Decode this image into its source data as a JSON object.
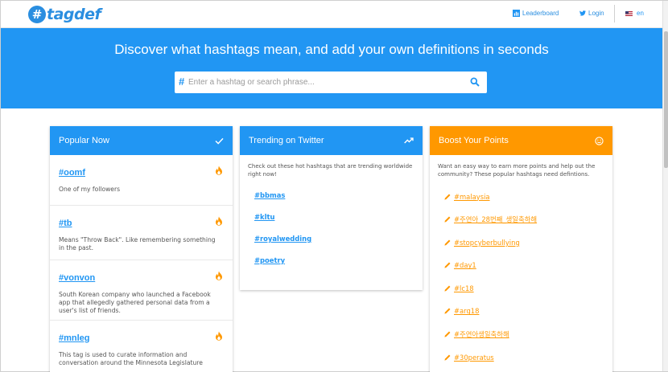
{
  "header": {
    "logo_hash": "#",
    "logo_text": "tagdef",
    "leaderboard_label": "Leaderboard",
    "login_label": "Login",
    "lang_label": "en"
  },
  "hero": {
    "title": "Discover what hashtags mean, and add your own definitions in seconds",
    "search_hash": "#",
    "search_placeholder": "Enter a hashtag or search phrase..."
  },
  "popular": {
    "title": "Popular Now",
    "items": [
      {
        "tag": "#oomf",
        "desc": "One of my followers"
      },
      {
        "tag": "#tb",
        "desc": "Means \"Throw Back\". Like remembering something in the past."
      },
      {
        "tag": "#vonvon",
        "desc": "South Korean company who launched a Facebook app that allegedly gathered personal data from a user's list of friends."
      },
      {
        "tag": "#mnleg",
        "desc": "This tag is used to curate information and conversation around the Minnesota Legislature"
      }
    ]
  },
  "trending": {
    "title": "Trending on Twitter",
    "intro": "Check out these hot hashtags that are trending worldwide right now!",
    "items": [
      "#bbmas",
      "#kltu",
      "#royalwedding",
      "#poetry"
    ]
  },
  "boost": {
    "title": "Boost Your Points",
    "intro": "Want an easy way to earn more points and help out the community? These popular hashtags need defintions.",
    "items": [
      "#malaysia",
      "#주연아_28번째_생일축하해",
      "#stopcyberbullying",
      "#day1",
      "#lc18",
      "#arg18",
      "#주연아생일축하해",
      "#30peratus"
    ]
  },
  "colors": {
    "primary": "#2196f3",
    "accent": "#ff9800",
    "fire": "#ff9800"
  }
}
